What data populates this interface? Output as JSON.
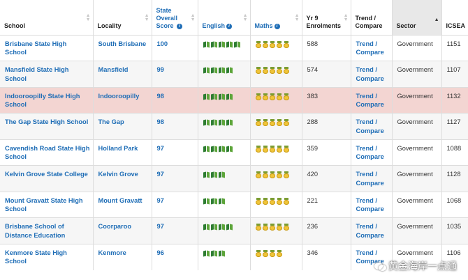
{
  "columns": {
    "school": "School",
    "locality": "Locality",
    "score": "State Overall Score",
    "english": "English",
    "maths": "Maths",
    "enrolments": "Yr 9 Enrolments",
    "trend": "Trend / Compare",
    "sector": "Sector",
    "icsea": "ICSEA"
  },
  "rows": [
    {
      "school": "Brisbane State High School",
      "locality": "South Brisbane",
      "score": "100",
      "english_rating": 5,
      "maths_rating": 5,
      "enrolments": "588",
      "trend": "Trend / Compare",
      "sector": "Government",
      "icsea": "1151"
    },
    {
      "school": "Mansfield State High School",
      "locality": "Mansfield",
      "score": "99",
      "english_rating": 4,
      "maths_rating": 5,
      "enrolments": "574",
      "trend": "Trend / Compare",
      "sector": "Government",
      "icsea": "1107"
    },
    {
      "school": "Indooroopilly State High School",
      "locality": "Indooroopilly",
      "score": "98",
      "english_rating": 4,
      "maths_rating": 5,
      "enrolments": "383",
      "trend": "Trend / Compare",
      "sector": "Government",
      "icsea": "1132"
    },
    {
      "school": "The Gap State High School",
      "locality": "The Gap",
      "score": "98",
      "english_rating": 4,
      "maths_rating": 5,
      "enrolments": "288",
      "trend": "Trend / Compare",
      "sector": "Government",
      "icsea": "1127"
    },
    {
      "school": "Cavendish Road State High School",
      "locality": "Holland Park",
      "score": "97",
      "english_rating": 4,
      "maths_rating": 5,
      "enrolments": "359",
      "trend": "Trend / Compare",
      "sector": "Government",
      "icsea": "1088"
    },
    {
      "school": "Kelvin Grove State College",
      "locality": "Kelvin Grove",
      "score": "97",
      "english_rating": 3,
      "maths_rating": 5,
      "enrolments": "420",
      "trend": "Trend / Compare",
      "sector": "Government",
      "icsea": "1128"
    },
    {
      "school": "Mount Gravatt State High School",
      "locality": "Mount Gravatt",
      "score": "97",
      "english_rating": 3,
      "maths_rating": 5,
      "enrolments": "221",
      "trend": "Trend / Compare",
      "sector": "Government",
      "icsea": "1068"
    },
    {
      "school": "Brisbane School of Distance Education",
      "locality": "Coorparoo",
      "score": "97",
      "english_rating": 4,
      "maths_rating": 5,
      "enrolments": "236",
      "trend": "Trend / Compare",
      "sector": "Government",
      "icsea": "1035"
    },
    {
      "school": "Kenmore State High School",
      "locality": "Kenmore",
      "score": "96",
      "english_rating": 3,
      "maths_rating": 4,
      "enrolments": "346",
      "trend": "Trend / Compare",
      "sector": "Government",
      "icsea": "1106"
    }
  ],
  "highlight_row": 2,
  "watermark": "黄金海岸一点通",
  "colors": {
    "link": "#1e6db6",
    "highlight": "#f3d5d2",
    "stripe": "#f6f6f6",
    "book": "#3d8b37",
    "medal": "#f0c53a"
  }
}
